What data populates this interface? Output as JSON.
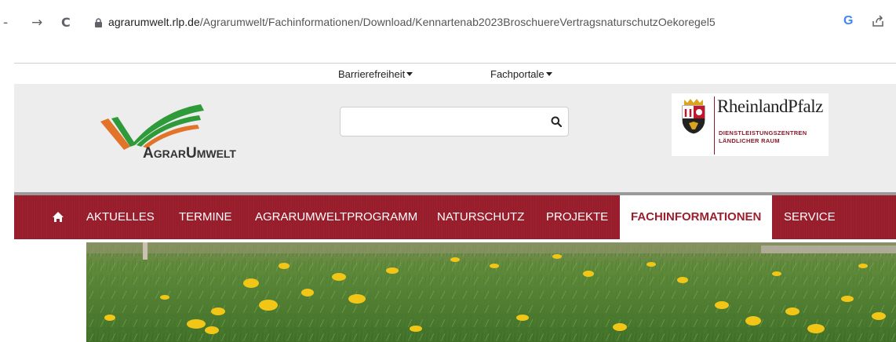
{
  "browser": {
    "back": "-",
    "forward": "→",
    "reload": "C",
    "url_host": "agrarumwelt.rlp.de",
    "url_path": "/Agrarumwelt/Fachinformationen/Download/Kennartenab2023BroschuereVertragsnaturschutzOekoregel5",
    "google_icon": "G",
    "icons": [
      "lock-icon",
      "google-icon",
      "share-icon"
    ]
  },
  "topmenu": {
    "items": [
      {
        "label": "Barrierefreiheit"
      },
      {
        "label": "Fachportale"
      }
    ]
  },
  "header": {
    "logo": {
      "big1": "A",
      "small1": "GRAR",
      "big2": "U",
      "small2": "MWELT"
    },
    "search": {
      "placeholder": "",
      "value": ""
    },
    "rlp": {
      "name": "RheinlandPfalz",
      "sub_line1": "DIENSTLEISTUNGSZENTREN",
      "sub_line2": "LÄNDLICHER RAUM"
    }
  },
  "mainnav": {
    "items": [
      {
        "label": "AKTUELLES"
      },
      {
        "label": "TERMINE"
      },
      {
        "label": "AGRARUMWELTPROGRAMM"
      },
      {
        "label": "NATURSCHUTZ"
      },
      {
        "label": "PROJEKTE"
      },
      {
        "label": "FACHINFORMATIONEN",
        "active": true
      },
      {
        "label": "SERVICE"
      }
    ]
  },
  "colors": {
    "brand_red": "#9c1f2e",
    "logo_green": "#2e9a3a",
    "logo_orange": "#e2742a"
  }
}
